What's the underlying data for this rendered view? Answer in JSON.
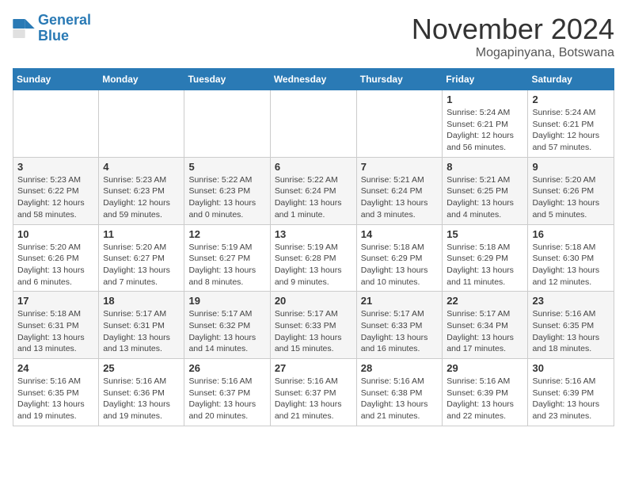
{
  "logo": {
    "line1": "General",
    "line2": "Blue"
  },
  "title": "November 2024",
  "subtitle": "Mogapinyana, Botswana",
  "weekdays": [
    "Sunday",
    "Monday",
    "Tuesday",
    "Wednesday",
    "Thursday",
    "Friday",
    "Saturday"
  ],
  "weeks": [
    [
      {
        "day": "",
        "info": ""
      },
      {
        "day": "",
        "info": ""
      },
      {
        "day": "",
        "info": ""
      },
      {
        "day": "",
        "info": ""
      },
      {
        "day": "",
        "info": ""
      },
      {
        "day": "1",
        "info": "Sunrise: 5:24 AM\nSunset: 6:21 PM\nDaylight: 12 hours\nand 56 minutes."
      },
      {
        "day": "2",
        "info": "Sunrise: 5:24 AM\nSunset: 6:21 PM\nDaylight: 12 hours\nand 57 minutes."
      }
    ],
    [
      {
        "day": "3",
        "info": "Sunrise: 5:23 AM\nSunset: 6:22 PM\nDaylight: 12 hours\nand 58 minutes."
      },
      {
        "day": "4",
        "info": "Sunrise: 5:23 AM\nSunset: 6:23 PM\nDaylight: 12 hours\nand 59 minutes."
      },
      {
        "day": "5",
        "info": "Sunrise: 5:22 AM\nSunset: 6:23 PM\nDaylight: 13 hours\nand 0 minutes."
      },
      {
        "day": "6",
        "info": "Sunrise: 5:22 AM\nSunset: 6:24 PM\nDaylight: 13 hours\nand 1 minute."
      },
      {
        "day": "7",
        "info": "Sunrise: 5:21 AM\nSunset: 6:24 PM\nDaylight: 13 hours\nand 3 minutes."
      },
      {
        "day": "8",
        "info": "Sunrise: 5:21 AM\nSunset: 6:25 PM\nDaylight: 13 hours\nand 4 minutes."
      },
      {
        "day": "9",
        "info": "Sunrise: 5:20 AM\nSunset: 6:26 PM\nDaylight: 13 hours\nand 5 minutes."
      }
    ],
    [
      {
        "day": "10",
        "info": "Sunrise: 5:20 AM\nSunset: 6:26 PM\nDaylight: 13 hours\nand 6 minutes."
      },
      {
        "day": "11",
        "info": "Sunrise: 5:20 AM\nSunset: 6:27 PM\nDaylight: 13 hours\nand 7 minutes."
      },
      {
        "day": "12",
        "info": "Sunrise: 5:19 AM\nSunset: 6:27 PM\nDaylight: 13 hours\nand 8 minutes."
      },
      {
        "day": "13",
        "info": "Sunrise: 5:19 AM\nSunset: 6:28 PM\nDaylight: 13 hours\nand 9 minutes."
      },
      {
        "day": "14",
        "info": "Sunrise: 5:18 AM\nSunset: 6:29 PM\nDaylight: 13 hours\nand 10 minutes."
      },
      {
        "day": "15",
        "info": "Sunrise: 5:18 AM\nSunset: 6:29 PM\nDaylight: 13 hours\nand 11 minutes."
      },
      {
        "day": "16",
        "info": "Sunrise: 5:18 AM\nSunset: 6:30 PM\nDaylight: 13 hours\nand 12 minutes."
      }
    ],
    [
      {
        "day": "17",
        "info": "Sunrise: 5:18 AM\nSunset: 6:31 PM\nDaylight: 13 hours\nand 13 minutes."
      },
      {
        "day": "18",
        "info": "Sunrise: 5:17 AM\nSunset: 6:31 PM\nDaylight: 13 hours\nand 13 minutes."
      },
      {
        "day": "19",
        "info": "Sunrise: 5:17 AM\nSunset: 6:32 PM\nDaylight: 13 hours\nand 14 minutes."
      },
      {
        "day": "20",
        "info": "Sunrise: 5:17 AM\nSunset: 6:33 PM\nDaylight: 13 hours\nand 15 minutes."
      },
      {
        "day": "21",
        "info": "Sunrise: 5:17 AM\nSunset: 6:33 PM\nDaylight: 13 hours\nand 16 minutes."
      },
      {
        "day": "22",
        "info": "Sunrise: 5:17 AM\nSunset: 6:34 PM\nDaylight: 13 hours\nand 17 minutes."
      },
      {
        "day": "23",
        "info": "Sunrise: 5:16 AM\nSunset: 6:35 PM\nDaylight: 13 hours\nand 18 minutes."
      }
    ],
    [
      {
        "day": "24",
        "info": "Sunrise: 5:16 AM\nSunset: 6:35 PM\nDaylight: 13 hours\nand 19 minutes."
      },
      {
        "day": "25",
        "info": "Sunrise: 5:16 AM\nSunset: 6:36 PM\nDaylight: 13 hours\nand 19 minutes."
      },
      {
        "day": "26",
        "info": "Sunrise: 5:16 AM\nSunset: 6:37 PM\nDaylight: 13 hours\nand 20 minutes."
      },
      {
        "day": "27",
        "info": "Sunrise: 5:16 AM\nSunset: 6:37 PM\nDaylight: 13 hours\nand 21 minutes."
      },
      {
        "day": "28",
        "info": "Sunrise: 5:16 AM\nSunset: 6:38 PM\nDaylight: 13 hours\nand 21 minutes."
      },
      {
        "day": "29",
        "info": "Sunrise: 5:16 AM\nSunset: 6:39 PM\nDaylight: 13 hours\nand 22 minutes."
      },
      {
        "day": "30",
        "info": "Sunrise: 5:16 AM\nSunset: 6:39 PM\nDaylight: 13 hours\nand 23 minutes."
      }
    ]
  ]
}
